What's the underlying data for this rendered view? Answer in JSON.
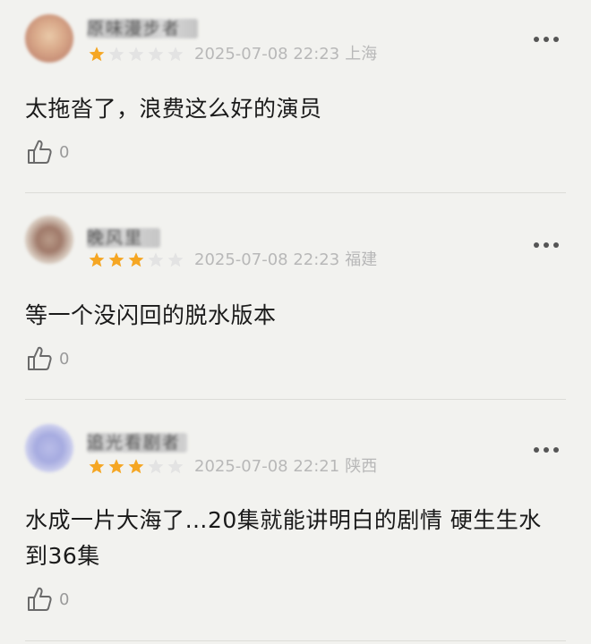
{
  "comments": [
    {
      "username": "原味漫步者",
      "rating": 1,
      "max_rating": 5,
      "timestamp": "2025-07-08 22:23",
      "location": "上海",
      "text": "太拖沓了，浪费这么好的演员",
      "likes": "0"
    },
    {
      "username": "晚风里",
      "rating": 3,
      "max_rating": 5,
      "timestamp": "2025-07-08 22:23",
      "location": "福建",
      "text": "等一个没闪回的脱水版本",
      "likes": "0"
    },
    {
      "username": "追光看剧者",
      "rating": 3,
      "max_rating": 5,
      "timestamp": "2025-07-08 22:21",
      "location": "陕西",
      "text": "水成一片大海了…20集就能讲明白的剧情 硬生生水到36集",
      "likes": "0"
    }
  ],
  "colors": {
    "star_filled": "#f5a623",
    "star_empty": "#e3e3e3",
    "meta_text": "#b8b8b8",
    "body_text": "#1a1a1a"
  },
  "icons": {
    "like": "thumbs-up-icon",
    "more": "more-dots-icon"
  }
}
